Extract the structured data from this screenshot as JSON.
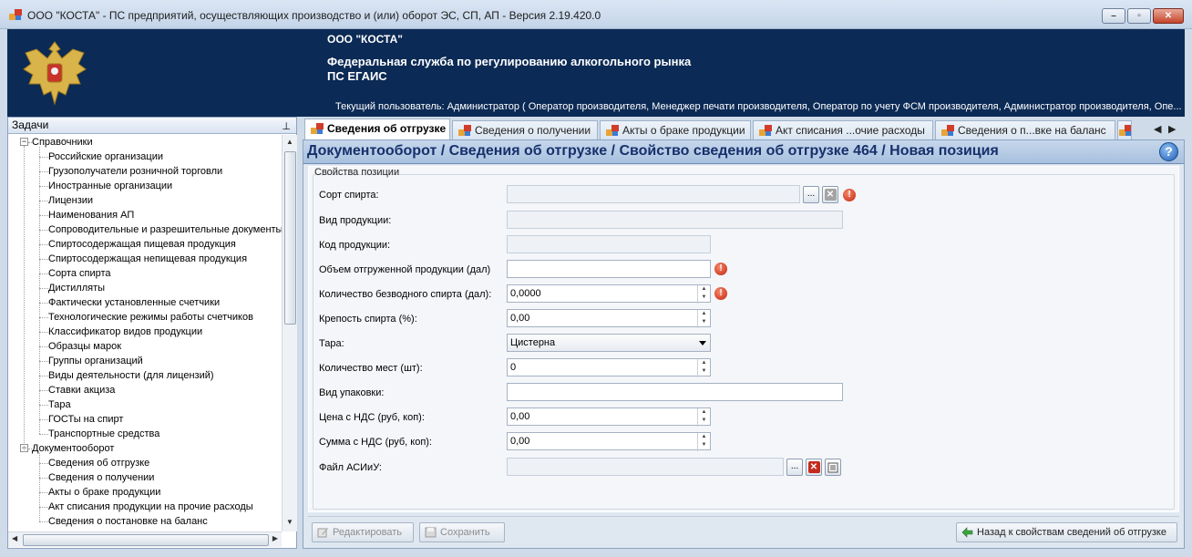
{
  "window": {
    "title": "ООО \"КОСТА\" - ПС предприятий, осуществляющих производство и (или) оборот ЭС, СП, АП - Версия 2.19.420.0"
  },
  "banner": {
    "org": "ООО \"КОСТА\"",
    "agency": "Федеральная служба по регулированию алкогольного рынка",
    "system": "ПС ЕГАИС",
    "user": "Текущий пользователь: Администратор ( Оператор производителя, Менеджер печати производителя, Оператор по учету ФСМ производителя, Администратор производителя, Опе..."
  },
  "tasks": {
    "title": "Задачи",
    "pin": "ㅁ",
    "tree": [
      {
        "label": "Справочники",
        "level": 0,
        "expander": "−"
      },
      {
        "label": "Российские организации",
        "level": 1
      },
      {
        "label": "Грузополучатели розничной торговли",
        "level": 1
      },
      {
        "label": "Иностранные организации",
        "level": 1
      },
      {
        "label": "Лицензии",
        "level": 1
      },
      {
        "label": "Наименования АП",
        "level": 1
      },
      {
        "label": "Сопроводительные и разрешительные документы",
        "level": 1
      },
      {
        "label": "Спиртосодержащая пищевая продукция",
        "level": 1
      },
      {
        "label": "Спиртосодержащая непищевая продукция",
        "level": 1
      },
      {
        "label": "Сорта спирта",
        "level": 1
      },
      {
        "label": "Дистилляты",
        "level": 1
      },
      {
        "label": "Фактически установленные счетчики",
        "level": 1
      },
      {
        "label": "Технологические режимы работы счетчиков",
        "level": 1
      },
      {
        "label": "Классификатор видов продукции",
        "level": 1
      },
      {
        "label": "Образцы марок",
        "level": 1
      },
      {
        "label": "Группы организаций",
        "level": 1
      },
      {
        "label": "Виды деятельности (для лицензий)",
        "level": 1
      },
      {
        "label": "Ставки акциза",
        "level": 1
      },
      {
        "label": "Тара",
        "level": 1
      },
      {
        "label": "ГОСТы на спирт",
        "level": 1
      },
      {
        "label": "Транспортные средства",
        "level": 1
      },
      {
        "label": "Документооборот",
        "level": 0,
        "expander": "−"
      },
      {
        "label": "Сведения об отгрузке",
        "level": 1
      },
      {
        "label": "Сведения о получении",
        "level": 1
      },
      {
        "label": "Акты о браке продукции",
        "level": 1
      },
      {
        "label": "Акт списания продукции на прочие расходы",
        "level": 1
      },
      {
        "label": "Сведения о постановке на баланс",
        "level": 1
      }
    ]
  },
  "tabs": [
    {
      "label": "Сведения об отгрузке",
      "active": true
    },
    {
      "label": "Сведения о получении",
      "active": false
    },
    {
      "label": "Акты о браке продукции",
      "active": false
    },
    {
      "label": "Акт списания ...очие расходы",
      "active": false
    },
    {
      "label": "Сведения о п...вке на баланс",
      "active": false
    }
  ],
  "tab_nav": {
    "prev": "◀",
    "next": "▶"
  },
  "breadcrumb": "Документооборот  / Сведения об отгрузке / Свойство сведения об отгрузке 464 / Новая позиция",
  "help": "?",
  "form": {
    "legend": "Свойства позиции",
    "fields": {
      "spirit_grade": {
        "label": "Сорт спирта:",
        "value": ""
      },
      "product_kind": {
        "label": "Вид продукции:",
        "value": ""
      },
      "product_code": {
        "label": "Код продукции:",
        "value": ""
      },
      "shipped_volume": {
        "label": "Объем отгруженной продукции (дал)",
        "value": ""
      },
      "anhydrous_qty": {
        "label": "Количество безводного спирта (дал):",
        "value": "0,0000"
      },
      "strength": {
        "label": "Крепость спирта (%):",
        "value": "0,00"
      },
      "tare": {
        "label": "Тара:",
        "value": "Цистерна"
      },
      "places_count": {
        "label": "Количество мест (шт):",
        "value": "0"
      },
      "package_kind": {
        "label": "Вид упаковки:",
        "value": ""
      },
      "price_vat": {
        "label": "Цена с НДС (руб, коп):",
        "value": "0,00"
      },
      "sum_vat": {
        "label": "Сумма с НДС (руб, коп):",
        "value": "0,00"
      },
      "asiiu_file": {
        "label": "Файл АСИиУ:",
        "value": ""
      }
    },
    "browse_label": "...",
    "delete_label": "✕",
    "warn_label": "!"
  },
  "buttons": {
    "edit": "Редактировать",
    "save": "Сохранить",
    "back": "Назад к свойствам сведений об отгрузке"
  }
}
